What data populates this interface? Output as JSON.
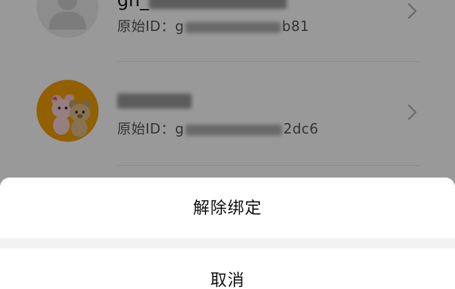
{
  "accounts": [
    {
      "name_visible": "gh_",
      "name_tail": "",
      "original_id_label": "原始ID：",
      "original_id_prefix": "g",
      "original_id_suffix": "b81",
      "avatar_icon": "default-person-icon"
    },
    {
      "name_visible": "",
      "name_tail": "",
      "original_id_label": "原始ID：",
      "original_id_prefix": "g",
      "original_id_suffix": "2dc6",
      "avatar_icon": "bears-avatar"
    }
  ],
  "action_sheet": {
    "unbind_label": "解除绑定",
    "cancel_label": "取消"
  },
  "colors": {
    "sheet_background": "#f2f2f2",
    "button_background": "#ffffff",
    "overlay": "rgba(0,0,0,0.40)",
    "avatar_orange": "#f4a100"
  }
}
